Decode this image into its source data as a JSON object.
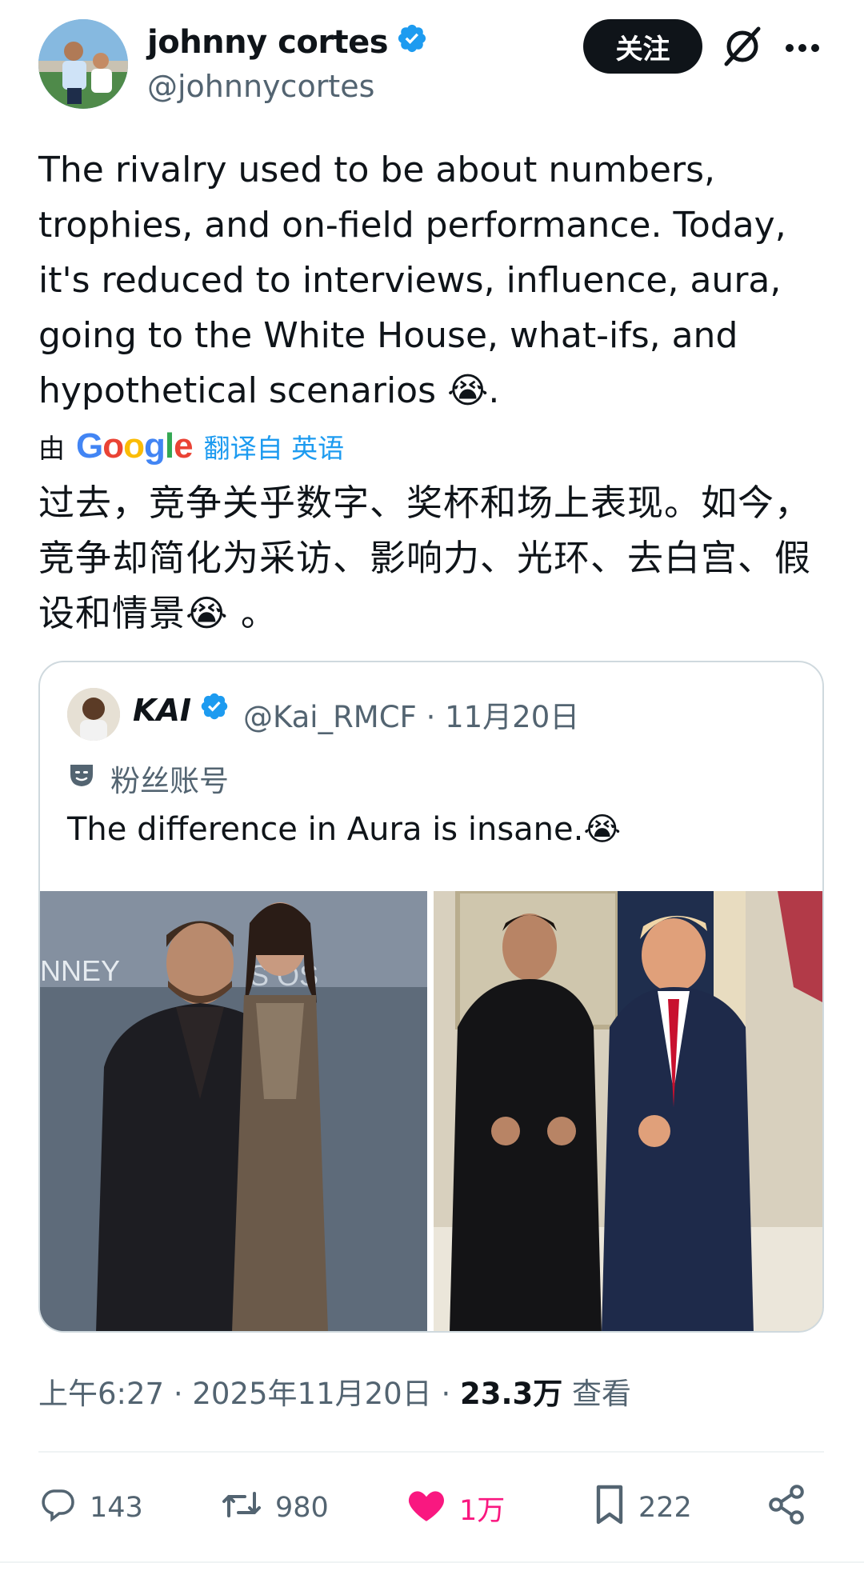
{
  "author": {
    "name": "johnny cortes",
    "handle": "@johnnycortes",
    "verified": true
  },
  "header": {
    "follow_label": "关注",
    "grok_icon": "grok-icon",
    "more_icon": "more-icon"
  },
  "tweet": {
    "text": "The rivalry used to be about numbers, trophies, and on-field performance. Today, it's reduced to interviews, influence, aura, going to the White House, what-ifs, and hypothetical scenarios 😭.",
    "translation_prefix": "由",
    "translation_brand": "Google",
    "translation_link": "翻译自 英语",
    "translated_text": "过去，竞争关乎数字、奖杯和场上表现。如今，竞争却简化为采访、影响力、光环、去白宫、假设和情景😭 。"
  },
  "quote": {
    "name": "KAI",
    "handle_date": "@Kai_RMCF · 11月20日",
    "label": "粉丝账号",
    "text": "The difference in Aura is insane.😭"
  },
  "meta": {
    "time": "上午6:27 · 2025年11月20日 · ",
    "views": "23.3万",
    "views_label": " 查看"
  },
  "actions": {
    "replies": "143",
    "reposts": "980",
    "likes": "1万",
    "bookmarks": "222"
  },
  "colors": {
    "accent": "#1d9bf0",
    "like": "#f91880",
    "text": "#0f1419",
    "muted": "#536471"
  }
}
